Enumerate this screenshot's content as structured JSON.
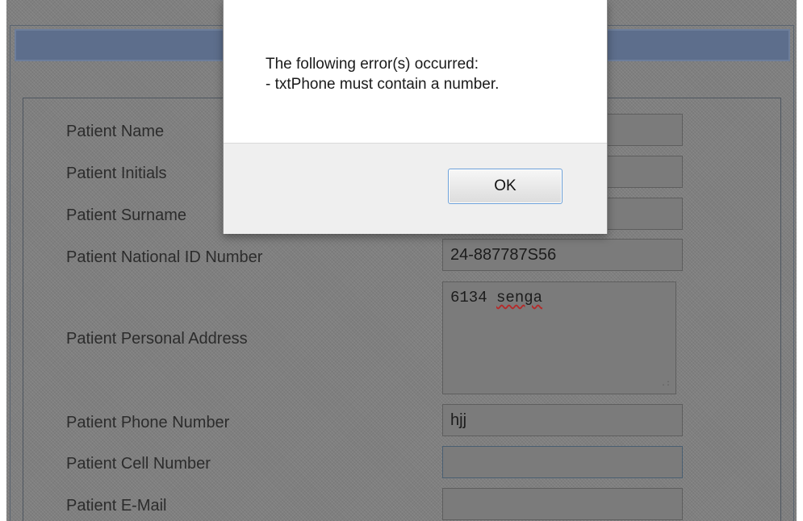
{
  "form": {
    "labels": {
      "name": "Patient Name",
      "initials": "Patient Initials",
      "surname": "Patient Surname",
      "national_id": "Patient National ID Number",
      "address": "Patient Personal Address",
      "phone": "Patient Phone Number",
      "cell": "Patient Cell Number",
      "email": "Patient E-Mail"
    },
    "values": {
      "name": "",
      "initials": "",
      "surname": "",
      "national_id": "24-887787S56",
      "address_number": "6134",
      "address_word": "senga",
      "phone": "hjj",
      "cell": "",
      "email": ""
    }
  },
  "dialog": {
    "line1": "The following error(s) occurred:",
    "line2": "- txtPhone must contain a number.",
    "ok_label": "OK"
  },
  "colors": {
    "header_bar": "#5d6e8c",
    "ok_button_border": "#6ca0d8"
  },
  "icons": {
    "resize_grip": "resize-grip-icon"
  }
}
